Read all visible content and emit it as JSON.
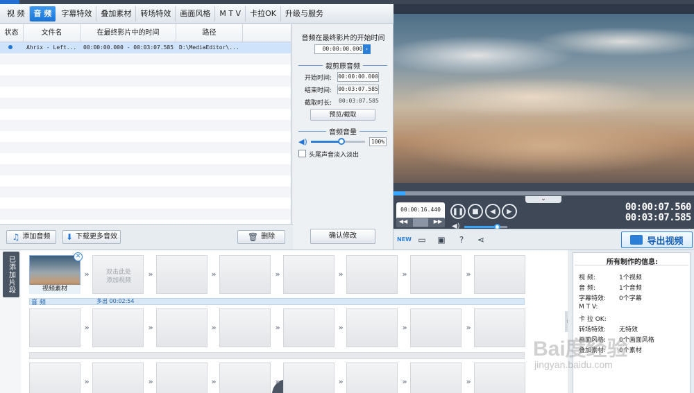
{
  "tabs": [
    "视 频",
    "音 频",
    "字幕特效",
    "叠加素材",
    "转场特效",
    "画面风格",
    "M T V",
    "卡拉OK",
    "升级与服务"
  ],
  "active_tab_index": 1,
  "file_list": {
    "columns": [
      "状态",
      "文件名",
      "在最终影片中的时间",
      "路径"
    ],
    "rows": [
      {
        "filename": "Ahrix - Left...",
        "time": "00:00:00.000 - 00:03:07.585",
        "path": "D:\\MediaEditor\\..."
      }
    ]
  },
  "list_buttons": {
    "add_audio": "添加音频",
    "download_more": "下载更多音效",
    "delete": "删除"
  },
  "settings": {
    "start_time_title": "音频在最终影片的开始时间",
    "start_time_value": "00:00:00.000",
    "trim_title": "裁剪原音频",
    "start_label": "开始时间:",
    "start_value": "00:00:00.000",
    "end_label": "结束时间:",
    "end_value": "00:03:07.585",
    "duration_label": "截取时长:",
    "duration_value": "00:03:07.585",
    "preview_button": "预览/截取",
    "volume_title": "音频音量",
    "volume_value": "100%",
    "volume_fraction": 0.57,
    "fade_label": "头尾声音淡入淡出",
    "confirm_button": "确认修改"
  },
  "player": {
    "current_time": "00:00:16.440",
    "time_display_1": "00:00:07.560",
    "time_display_2": "00:03:07.585",
    "seek_fraction": 0.04,
    "volume_fraction": 0.75
  },
  "export_button": "导出视频",
  "timeline": {
    "side_tab": "已添加片段",
    "clip_label": "视频素材",
    "empty_hint_line1": "双击此处",
    "empty_hint_line2": "添加视频",
    "audio_track_name": "音 频",
    "audio_track_extra": "多出 00:02:54"
  },
  "info": {
    "title": "所有制作的信息:",
    "items": [
      {
        "label": "视    频:",
        "value": "1个视频"
      },
      {
        "label": "音    频:",
        "value": "1个音频"
      },
      {
        "label": "字幕特效:",
        "value": "0个字幕"
      },
      {
        "label": "M  T  V:",
        "value": ""
      },
      {
        "label": "卡 拉 OK:",
        "value": ""
      },
      {
        "label": "转场特效:",
        "value": "无特效"
      },
      {
        "label": "画面风格:",
        "value": "0个画面风格"
      },
      {
        "label": "叠加素材:",
        "value": "0个素材"
      }
    ]
  },
  "watermark": {
    "line1": "Bai度经验",
    "line2": "jingyan.baidu.com"
  },
  "colors": {
    "accent": "#1f74d6",
    "toolbar": "#3f4857"
  }
}
